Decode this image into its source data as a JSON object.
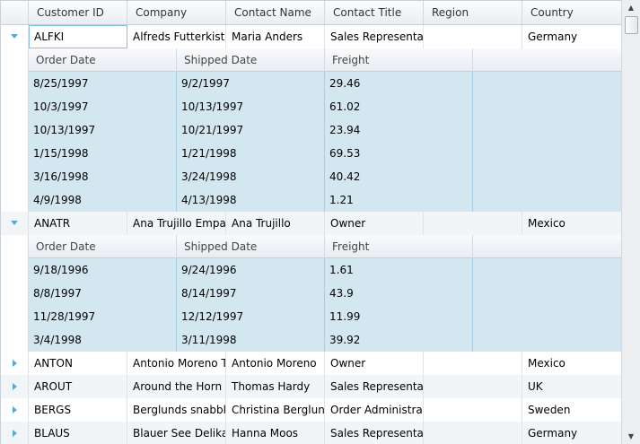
{
  "columns": {
    "customer_id": "Customer ID",
    "company": "Company",
    "contact_name": "Contact Name",
    "contact_title": "Contact Title",
    "region": "Region",
    "country": "Country"
  },
  "detail_columns": {
    "order_date": "Order Date",
    "shipped_date": "Shipped Date",
    "freight": "Freight"
  },
  "customers": [
    {
      "id": "ALFKI",
      "company": "Alfreds Futterkiste",
      "contact": "Maria Anders",
      "title": "Sales Representative",
      "region": "",
      "country": "Germany",
      "orders": [
        {
          "order_date": "8/25/1997",
          "shipped_date": "9/2/1997",
          "freight": "29.46"
        },
        {
          "order_date": "10/3/1997",
          "shipped_date": "10/13/1997",
          "freight": "61.02"
        },
        {
          "order_date": "10/13/1997",
          "shipped_date": "10/21/1997",
          "freight": "23.94"
        },
        {
          "order_date": "1/15/1998",
          "shipped_date": "1/21/1998",
          "freight": "69.53"
        },
        {
          "order_date": "3/16/1998",
          "shipped_date": "3/24/1998",
          "freight": "40.42"
        },
        {
          "order_date": "4/9/1998",
          "shipped_date": "4/13/1998",
          "freight": "1.21"
        }
      ]
    },
    {
      "id": "ANATR",
      "company": "Ana Trujillo Emparedados",
      "contact": "Ana Trujillo",
      "title": "Owner",
      "region": "",
      "country": "Mexico",
      "orders": [
        {
          "order_date": "9/18/1996",
          "shipped_date": "9/24/1996",
          "freight": "1.61"
        },
        {
          "order_date": "8/8/1997",
          "shipped_date": "8/14/1997",
          "freight": "43.9"
        },
        {
          "order_date": "11/28/1997",
          "shipped_date": "12/12/1997",
          "freight": "11.99"
        },
        {
          "order_date": "3/4/1998",
          "shipped_date": "3/11/1998",
          "freight": "39.92"
        }
      ]
    },
    {
      "id": "ANTON",
      "company": "Antonio Moreno Taquería",
      "contact": "Antonio Moreno",
      "title": "Owner",
      "region": "",
      "country": "Mexico"
    },
    {
      "id": "AROUT",
      "company": "Around the Horn",
      "contact": "Thomas Hardy",
      "title": "Sales Representative",
      "region": "",
      "country": "UK"
    },
    {
      "id": "BERGS",
      "company": "Berglunds snabbköp",
      "contact": "Christina Berglund",
      "title": "Order Administrator",
      "region": "",
      "country": "Sweden"
    },
    {
      "id": "BLAUS",
      "company": "Blauer See Delikatessen",
      "contact": "Hanna Moos",
      "title": "Sales Representative",
      "region": "",
      "country": "Germany"
    }
  ],
  "colors": {
    "detail_bg": "#d3e7f1",
    "expander": "#57a9d6",
    "current_cell_border": "#82c1e3"
  },
  "icons": {
    "expanded": "triangle-down-icon",
    "collapsed": "triangle-right-icon",
    "scroll_up": "scroll-up-arrow-icon",
    "scroll_down": "scroll-down-arrow-icon"
  }
}
